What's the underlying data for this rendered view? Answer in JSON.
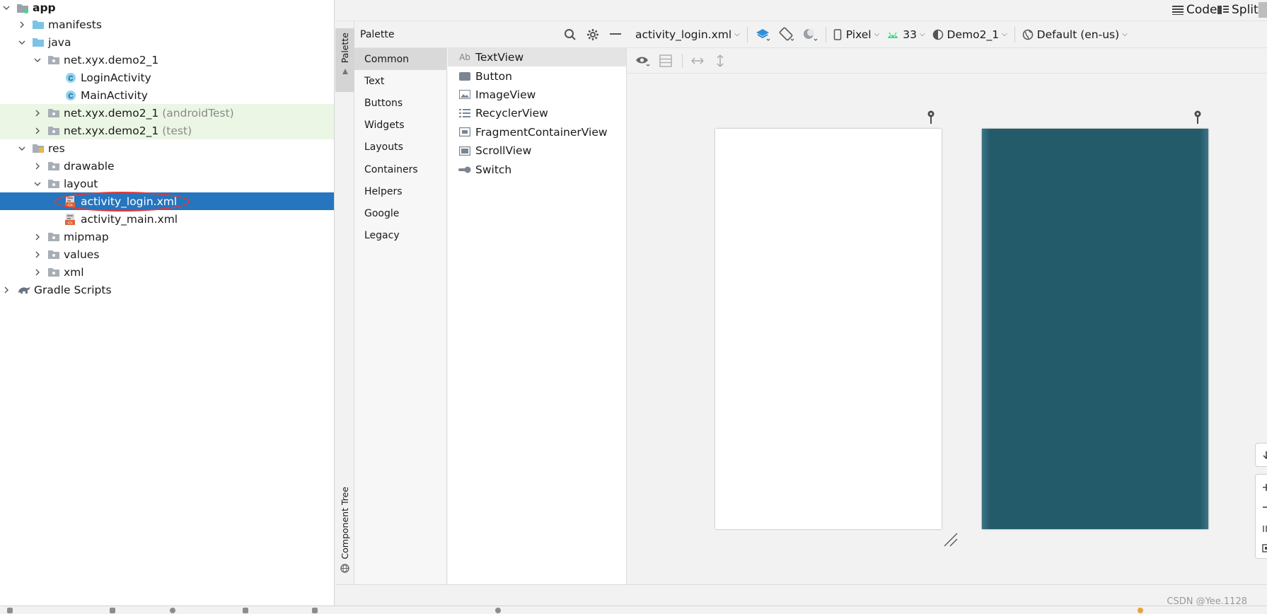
{
  "project_tree": {
    "items": [
      {
        "label": "app",
        "suffix": "",
        "icon": "module-folder-icon",
        "expanded": true,
        "bold": true
      },
      {
        "label": "manifests",
        "suffix": "",
        "icon": "folder-icon",
        "expanded": false
      },
      {
        "label": "java",
        "suffix": "",
        "icon": "folder-icon",
        "expanded": true
      },
      {
        "label": "net.xyx.demo2_1",
        "suffix": "",
        "icon": "package-icon",
        "expanded": true
      },
      {
        "label": "LoginActivity",
        "suffix": "",
        "icon": "class-icon"
      },
      {
        "label": "MainActivity",
        "suffix": "",
        "icon": "class-icon"
      },
      {
        "label": "net.xyx.demo2_1",
        "suffix": "(androidTest)",
        "icon": "package-icon",
        "expanded": false
      },
      {
        "label": "net.xyx.demo2_1",
        "suffix": "(test)",
        "icon": "package-icon",
        "expanded": false
      },
      {
        "label": "res",
        "suffix": "",
        "icon": "resource-folder-icon",
        "expanded": true
      },
      {
        "label": "drawable",
        "suffix": "",
        "icon": "package-icon",
        "expanded": false
      },
      {
        "label": "layout",
        "suffix": "",
        "icon": "package-icon",
        "expanded": true
      },
      {
        "label": "activity_login.xml",
        "suffix": "",
        "icon": "layout-file-icon"
      },
      {
        "label": "activity_main.xml",
        "suffix": "",
        "icon": "layout-file-icon"
      },
      {
        "label": "mipmap",
        "suffix": "",
        "icon": "package-icon",
        "expanded": false
      },
      {
        "label": "values",
        "suffix": "",
        "icon": "package-icon",
        "expanded": false
      },
      {
        "label": "xml",
        "suffix": "",
        "icon": "package-icon",
        "expanded": false
      },
      {
        "label": "Gradle Scripts",
        "suffix": "",
        "icon": "gradle-icon",
        "expanded": false
      }
    ],
    "selected_index": 11
  },
  "side_tabs": {
    "palette": "Palette",
    "component_tree": "Component Tree"
  },
  "palette": {
    "title": "Palette",
    "categories": [
      "Common",
      "Text",
      "Buttons",
      "Widgets",
      "Layouts",
      "Containers",
      "Helpers",
      "Google",
      "Legacy"
    ],
    "active_category": 0,
    "items": [
      {
        "label": "TextView",
        "icon": "textview-icon"
      },
      {
        "label": "Button",
        "icon": "button-icon"
      },
      {
        "label": "ImageView",
        "icon": "imageview-icon"
      },
      {
        "label": "RecyclerView",
        "icon": "recyclerview-icon"
      },
      {
        "label": "FragmentContainerView",
        "icon": "fragment-icon"
      },
      {
        "label": "ScrollView",
        "icon": "scrollview-icon"
      },
      {
        "label": "Switch",
        "icon": "switch-icon"
      }
    ],
    "textview_icon_text": "Ab"
  },
  "view_modes": {
    "code": "Code",
    "split": "Split"
  },
  "toolbar": {
    "file": "activity_login.xml",
    "device": "Pixel",
    "api": "33",
    "theme": "Demo2_1",
    "locale": "Default (en-us)"
  },
  "colors": {
    "selection": "#2675bf",
    "tinted_row": "#ecf6e4",
    "blueprint": "#235b6b",
    "android_green": "#3ddc84",
    "annotation_red": "#e03a3a"
  },
  "watermark": "CSDN @Yee.1128"
}
